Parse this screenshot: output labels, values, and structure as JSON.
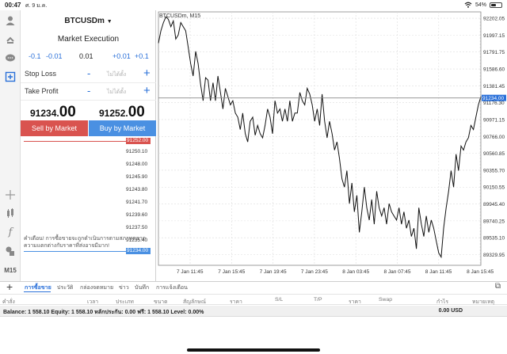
{
  "status": {
    "time": "00:47",
    "date": "ศ. 9 ม.ค.",
    "battery": "54%",
    "battery_level": 0.54
  },
  "toolbar": {
    "icons": [
      "user-icon",
      "trade-icon",
      "chat-icon",
      "new-order-icon",
      "crosshair-icon",
      "indicators-icon",
      "function-icon",
      "objects-icon"
    ],
    "timeframe": "M15"
  },
  "order": {
    "symbol": "BTCUSDm",
    "execution": "Market Execution",
    "volume_steps": [
      "-0.1",
      "-0.01",
      "+0.01",
      "+0.1"
    ],
    "volume": "0.01",
    "stop_loss_label": "Stop Loss",
    "take_profit_label": "Take Profit",
    "not_set": "ไม่ได้ตั้ง",
    "minus": "-",
    "plus": "+",
    "sell_price_main": "91234.",
    "sell_price_big": "00",
    "buy_price_main": "91252.",
    "buy_price_big": "00",
    "sell_button": "Sell by Market",
    "buy_button": "Buy by Market",
    "ladder_prices": [
      "91252.00",
      "91250.10",
      "91248.00",
      "91245.90",
      "91243.80",
      "91241.70",
      "91239.60",
      "91237.50",
      "91235.40",
      "91234.00"
    ],
    "ask_color": "#d9534f",
    "bid_color": "#4a90e2",
    "warning": "คำเตือน! การซื้อขายจะถูกดำเนินการตามสภาพตลาด ความแตกต่างกับราคาที่ส่งอาจมีมาก!"
  },
  "chart_data": {
    "type": "line",
    "title": "BTCUSDm, M15",
    "x_ticks": [
      "7 Jan 11:45",
      "7 Jan 15:45",
      "7 Jan 19:45",
      "7 Jan 23:45",
      "8 Jan 03:45",
      "8 Jan 07:45",
      "8 Jan 11:45",
      "8 Jan 15:45"
    ],
    "y_ticks": [
      "92202.05",
      "91997.15",
      "91791.75",
      "91586.60",
      "91381.45",
      "91176.30",
      "90971.15",
      "90766.00",
      "90560.85",
      "90355.70",
      "90150.55",
      "89945.40",
      "89740.25",
      "89535.10",
      "89329.95"
    ],
    "ylim": [
      89200,
      92280
    ],
    "current_price": "91234.00",
    "grid": true,
    "values": [
      91900,
      92050,
      92150,
      92220,
      92190,
      92100,
      92170,
      91950,
      92000,
      92150,
      92100,
      92050,
      91850,
      91650,
      91500,
      91800,
      91650,
      91400,
      91200,
      91480,
      91450,
      91200,
      91420,
      91200,
      91500,
      91300,
      91100,
      91350,
      91250,
      91150,
      91200,
      91050,
      91000,
      90850,
      91050,
      90800,
      90700,
      90950,
      91000,
      90780,
      90900,
      90800,
      90750,
      90900,
      91100,
      91000,
      90800,
      91200,
      91050,
      91100,
      90950,
      91100,
      90950,
      91200,
      90950,
      91050,
      91050,
      91300,
      91200,
      91150,
      91350,
      91280,
      91150,
      90950,
      91100,
      90900,
      91280,
      90950,
      90750,
      90950,
      90800,
      90600,
      90700,
      90500,
      90250,
      90150,
      90350,
      89950,
      90200,
      89850,
      90050,
      89600,
      89850,
      90150,
      89900,
      89750,
      90000,
      89700,
      90100,
      89900,
      89800,
      89900,
      89700,
      89950,
      89850,
      89800,
      89750,
      89900,
      89700,
      89850,
      89650,
      89750,
      89550,
      89650,
      89400,
      89900,
      89700,
      89550,
      89800,
      89600,
      89750,
      89650,
      89500,
      89350,
      89300,
      89650,
      89900,
      90100,
      90350,
      90150,
      90550,
      90350,
      90650,
      90600,
      90700,
      90750,
      90900,
      90850,
      91000,
      91150,
      91250
    ]
  },
  "terminal": {
    "tabs": [
      "การซื้อขาย",
      "ประวัติ",
      "กล่องจดหมาย",
      "ข่าว",
      "บันทึก",
      "การแจ้งเตือน"
    ],
    "columns": [
      "คำสั่ง",
      "เวลา",
      "ประเภท",
      "ขนาด",
      "สัญลักษณ์",
      "ราคา",
      "S/L",
      "T/P",
      "ราคา",
      "Swap",
      "กำไร",
      "หมายเหตุ"
    ],
    "balance_line": "Balance: 1 558.10 Equity: 1 558.10 หลักประกัน: 0.00 ฟรี: 1 558.10 Level: 0.00%",
    "profit_total": "0.00",
    "currency": "USD"
  }
}
